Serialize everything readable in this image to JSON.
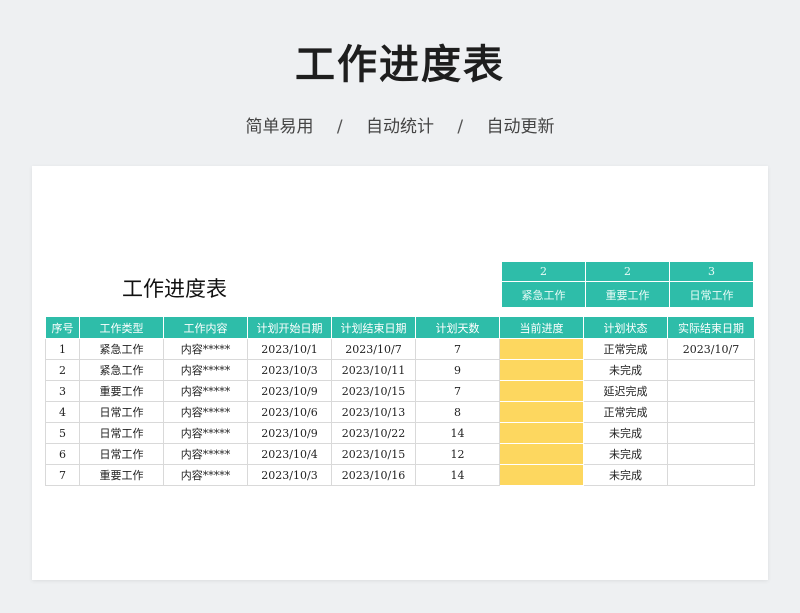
{
  "banner": {
    "title": "工作进度表",
    "features": [
      "简单易用",
      "自动统计",
      "自动更新"
    ],
    "separator": "/"
  },
  "sheet": {
    "title": "工作进度表",
    "summary": [
      {
        "count": "2",
        "label": "紧急工作"
      },
      {
        "count": "2",
        "label": "重要工作"
      },
      {
        "count": "3",
        "label": "日常工作"
      }
    ],
    "columns": [
      "序号",
      "工作类型",
      "工作内容",
      "计划开始日期",
      "计划结束日期",
      "计划天数",
      "当前进度",
      "计划状态",
      "实际结束日期"
    ],
    "rows": [
      {
        "no": "1",
        "type": "紧急工作",
        "content": "内容*****",
        "start": "2023/10/1",
        "end": "2023/10/7",
        "days": "7",
        "progress": "",
        "status": "正常完成",
        "actual_end": "2023/10/7"
      },
      {
        "no": "2",
        "type": "紧急工作",
        "content": "内容*****",
        "start": "2023/10/3",
        "end": "2023/10/11",
        "days": "9",
        "progress": "",
        "status": "未完成",
        "actual_end": ""
      },
      {
        "no": "3",
        "type": "重要工作",
        "content": "内容*****",
        "start": "2023/10/9",
        "end": "2023/10/15",
        "days": "7",
        "progress": "",
        "status": "延迟完成",
        "actual_end": ""
      },
      {
        "no": "4",
        "type": "日常工作",
        "content": "内容*****",
        "start": "2023/10/6",
        "end": "2023/10/13",
        "days": "8",
        "progress": "",
        "status": "正常完成",
        "actual_end": ""
      },
      {
        "no": "5",
        "type": "日常工作",
        "content": "内容*****",
        "start": "2023/10/9",
        "end": "2023/10/22",
        "days": "14",
        "progress": "",
        "status": "未完成",
        "actual_end": ""
      },
      {
        "no": "6",
        "type": "日常工作",
        "content": "内容*****",
        "start": "2023/10/4",
        "end": "2023/10/15",
        "days": "12",
        "progress": "",
        "status": "未完成",
        "actual_end": ""
      },
      {
        "no": "7",
        "type": "重要工作",
        "content": "内容*****",
        "start": "2023/10/3",
        "end": "2023/10/16",
        "days": "14",
        "progress": "",
        "status": "未完成",
        "actual_end": ""
      }
    ]
  },
  "colors": {
    "header_teal": "#2ebda9",
    "progress_yellow": "#fdd75f",
    "page_background": "#eef0f2"
  }
}
